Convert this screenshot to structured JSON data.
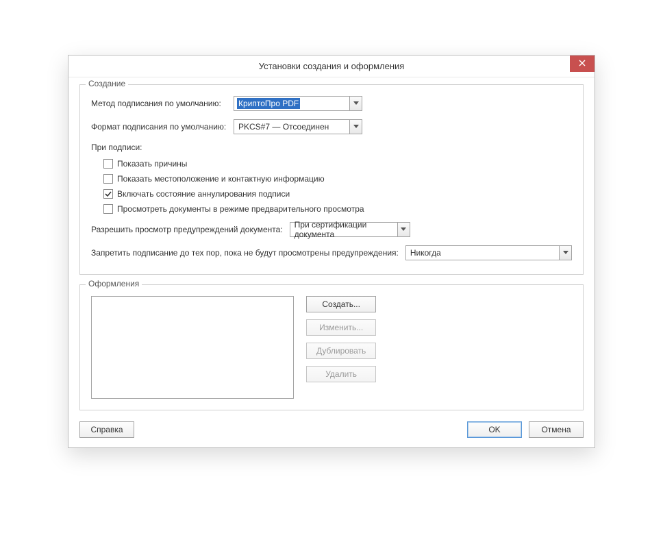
{
  "window": {
    "title": "Установки создания и оформления"
  },
  "creation": {
    "group_title": "Создание",
    "method_label": "Метод подписания по умолчанию:",
    "method_value": "КриптоПро PDF",
    "format_label": "Формат подписания по умолчанию:",
    "format_value": "PKCS#7 — Отсоединен",
    "when_signing_label": "При подписи:",
    "checks": {
      "show_reasons": "Показать причины",
      "show_location": "Показать местоположение и контактную информацию",
      "include_revocation": "Включать состояние аннулирования подписи",
      "preview_docs": "Просмотреть документы в режиме предварительного просмотра"
    },
    "warnings_view_label": "Разрешить просмотр предупреждений документа:",
    "warnings_view_value": "При сертификации документа",
    "prevent_sign_label": "Запретить подписание до тех пор, пока не будут просмотрены предупреждения:",
    "prevent_sign_value": "Никогда"
  },
  "appearance": {
    "group_title": "Оформления",
    "buttons": {
      "create": "Создать...",
      "edit": "Изменить...",
      "duplicate": "Дублировать",
      "delete": "Удалить"
    }
  },
  "footer": {
    "help": "Справка",
    "ok": "OK",
    "cancel": "Отмена"
  }
}
